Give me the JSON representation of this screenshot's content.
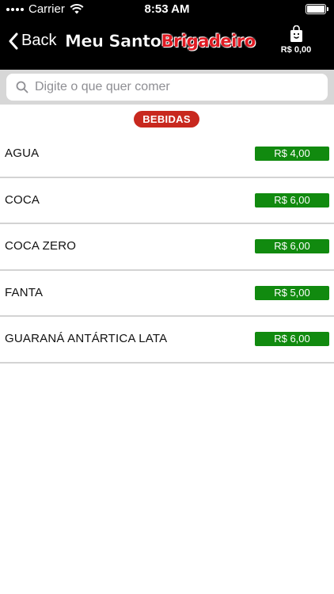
{
  "status_bar": {
    "carrier": "Carrier",
    "time": "8:53 AM"
  },
  "nav": {
    "back_label": "Back",
    "logo_part1": "Meu Santo",
    "logo_part2": "Brigadeiro",
    "cart_total": "R$ 0,00",
    "cart_icon": "shopping-bag-icon"
  },
  "search": {
    "placeholder": "Digite o que quer comer",
    "value": ""
  },
  "category": {
    "label": "BEBIDAS"
  },
  "items": [
    {
      "name": "AGUA",
      "price": "R$ 4,00"
    },
    {
      "name": "COCA",
      "price": "R$ 6,00"
    },
    {
      "name": "COCA ZERO",
      "price": "R$ 6,00"
    },
    {
      "name": "FANTA",
      "price": "R$ 5,00"
    },
    {
      "name": "GUARANÁ ANTÁRTICA LATA",
      "price": "R$ 6,00"
    }
  ],
  "colors": {
    "header_bg": "#000000",
    "brand_red": "#e01a22",
    "category_badge": "#c8281e",
    "price_badge": "#118a0f",
    "search_bar_bg": "#d7d7d7"
  }
}
